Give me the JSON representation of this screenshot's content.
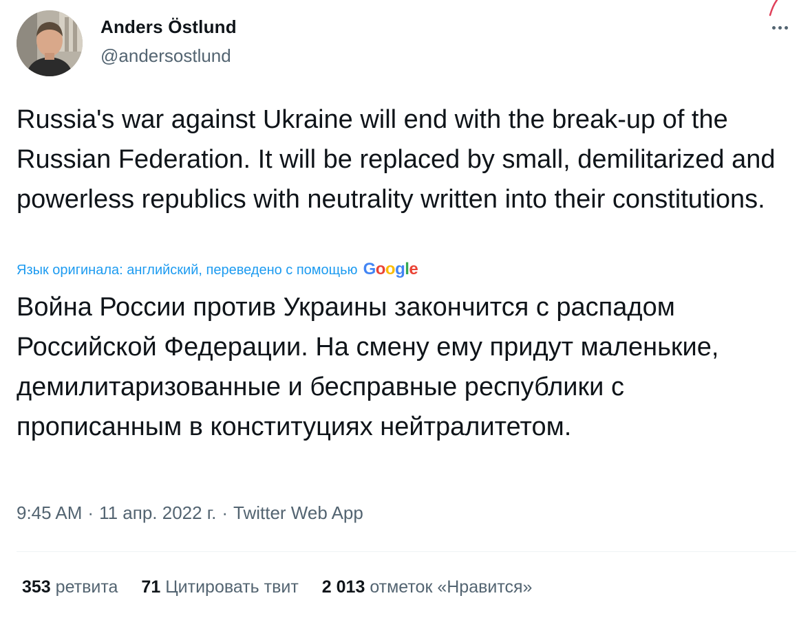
{
  "colors": {
    "link_blue": "#1d9bf0",
    "secondary_text": "#536471",
    "primary_text": "#0f1419"
  },
  "author": {
    "name": "Anders Östlund",
    "handle": "@andersostlund"
  },
  "tweet": {
    "original_text": "Russia's war against Ukraine will end with the break-up of the Russian Federation. It will be replaced by small, demilitarized and powerless republics with neutrality written into their constitutions.",
    "translation_note": "Язык оригинала: английский, переведено с помощью",
    "translation_provider": "Google",
    "translated_text": "Война России против Украины закончится с распадом Российской Федерации. На смену ему придут маленькие, демилитаризованные и бесправные республики с прописанным в конституциях нейтралитетом."
  },
  "meta": {
    "time": "9:45 AM",
    "separator": "·",
    "date": "11 апр. 2022 г.",
    "source": "Twitter Web App"
  },
  "stats": {
    "retweets_count": "353",
    "retweets_label": "ретвита",
    "quotes_count": "71",
    "quotes_label": "Цитировать твит",
    "likes_count": "2 013",
    "likes_label": "отметок «Нравится»"
  },
  "icons": {
    "more": "more-horizontal-icon"
  }
}
